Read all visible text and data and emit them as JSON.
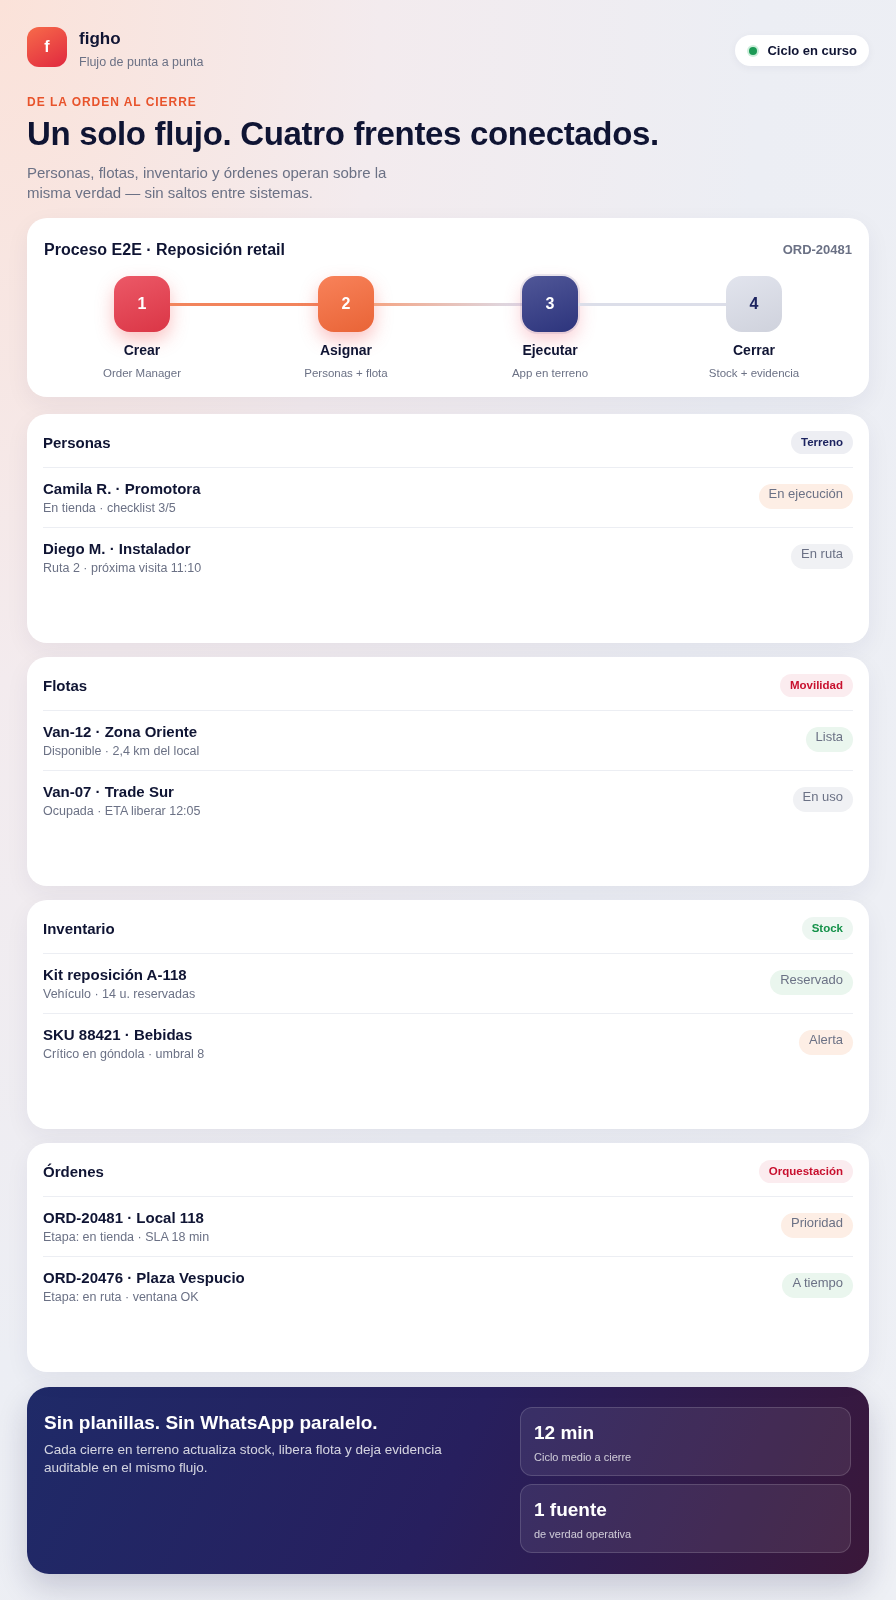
{
  "brand": {
    "logo_letter": "f",
    "name": "figho",
    "tagline": "Flujo de punta a punta"
  },
  "status_pill": {
    "label": "Ciclo en curso"
  },
  "hero": {
    "eyebrow": "DE LA ORDEN AL CIERRE",
    "title": "Un solo flujo. Cuatro frentes conectados.",
    "text": "Personas, flotas, inventario y órdenes operan sobre la misma verdad — sin saltos entre sistemas."
  },
  "process": {
    "title": "Proceso E2E · Reposición retail",
    "order_id": "ORD-20481",
    "steps": [
      {
        "number": "1",
        "label": "Crear",
        "detail": "Order Manager",
        "completed": true,
        "current": false,
        "color": "#e8394a"
      },
      {
        "number": "2",
        "label": "Asignar",
        "detail": "Personas + flota",
        "completed": true,
        "current": false,
        "color": "#f76a3a"
      },
      {
        "number": "3",
        "label": "Ejecutar",
        "detail": "App en terreno",
        "completed": false,
        "current": true,
        "color": "#2f3784"
      },
      {
        "number": "4",
        "label": "Cerrar",
        "detail": "Stock + evidencia",
        "completed": false,
        "current": false,
        "color": "#dcdfea"
      }
    ]
  },
  "sections": [
    {
      "title": "Personas",
      "tag": {
        "label": "Terreno",
        "color": "#1d2460"
      },
      "items": [
        {
          "title": "Camila R. · Promotora",
          "detail": "En tienda · checklist 3/5",
          "status": {
            "label": "En ejecución",
            "color": "#fdeee5"
          }
        },
        {
          "title": "Diego M. · Instalador",
          "detail": "Ruta 2 · próxima visita 11:10",
          "status": {
            "label": "En ruta",
            "color": "#f0f1f4"
          }
        }
      ]
    },
    {
      "title": "Flotas",
      "tag": {
        "label": "Movilidad",
        "color": "#c8102e"
      },
      "items": [
        {
          "title": "Van-12 · Zona Oriente",
          "detail": "Disponible · 2,4 km del local",
          "status": {
            "label": "Lista",
            "color": "#eaf6ee"
          }
        },
        {
          "title": "Van-07 · Trade Sur",
          "detail": "Ocupada · ETA liberar 12:05",
          "status": {
            "label": "En uso",
            "color": "#f0f1f4"
          }
        }
      ]
    },
    {
      "title": "Inventario",
      "tag": {
        "label": "Stock",
        "color": "#15924a"
      },
      "items": [
        {
          "title": "Kit reposición A-118",
          "detail": "Vehículo · 14 u. reservadas",
          "status": {
            "label": "Reservado",
            "color": "#eaf6ee"
          }
        },
        {
          "title": "SKU 88421 · Bebidas",
          "detail": "Crítico en góndola · umbral 8",
          "status": {
            "label": "Alerta",
            "color": "#fdeee5"
          }
        }
      ]
    },
    {
      "title": "Órdenes",
      "tag": {
        "label": "Orquestación",
        "color": "#c8102e"
      },
      "items": [
        {
          "title": "ORD-20481 · Local 118",
          "detail": "Etapa: en tienda · SLA 18 min",
          "status": {
            "label": "Prioridad",
            "color": "#fdeee5"
          }
        },
        {
          "title": "ORD-20476 · Plaza Vespucio",
          "detail": "Etapa: en ruta · ventana OK",
          "status": {
            "label": "A tiempo",
            "color": "#eaf6ee"
          }
        }
      ]
    }
  ],
  "footer": {
    "title": "Sin planillas. Sin WhatsApp paralelo.",
    "text": "Cada cierre en terreno actualiza stock, libera flota y deja evidencia auditable en el mismo flujo.",
    "stats": [
      {
        "value": "12 min",
        "label": "Ciclo medio a cierre"
      },
      {
        "value": "1 fuente",
        "label": "de verdad operativa"
      }
    ]
  }
}
